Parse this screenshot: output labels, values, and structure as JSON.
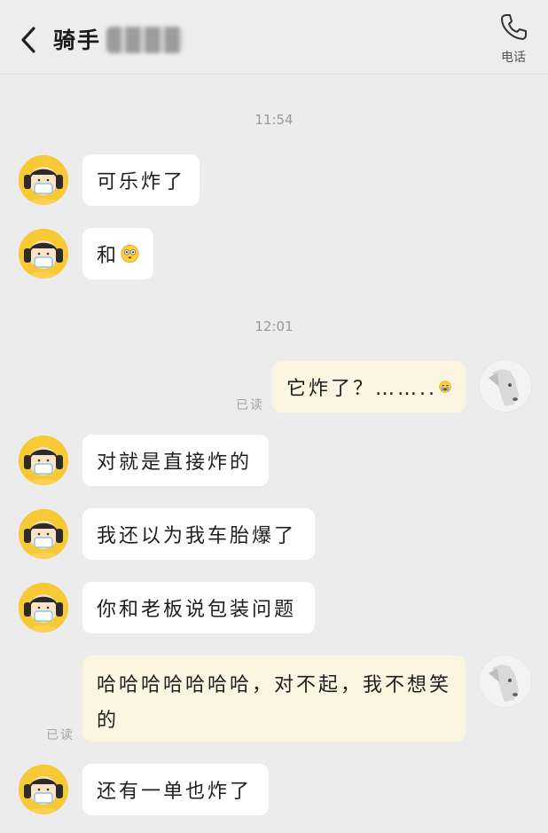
{
  "header": {
    "title": "骑手",
    "call_label": "电话"
  },
  "times": [
    "11:54",
    "12:01"
  ],
  "messages": [
    {
      "side": "left",
      "text": "可乐炸了"
    },
    {
      "side": "left",
      "text": "和",
      "emoji": "flushed-face-icon"
    },
    {
      "side": "right",
      "text": "它炸了？……..",
      "emoji": "crying-face-icon",
      "status": "已读"
    },
    {
      "side": "left",
      "text": "对就是直接炸的"
    },
    {
      "side": "left",
      "text": "我还以为我车胎爆了"
    },
    {
      "side": "left",
      "text": "你和老板说包装问题"
    },
    {
      "side": "right",
      "text": "哈哈哈哈哈哈哈，对不起，我不想笑的",
      "status": "已读"
    },
    {
      "side": "left",
      "text": "还有一单也炸了"
    }
  ],
  "colors": {
    "background": "#ececec",
    "left_bubble": "#ffffff",
    "right_bubble": "#fbf5e2",
    "avatar_yellow": "#f6c935"
  }
}
